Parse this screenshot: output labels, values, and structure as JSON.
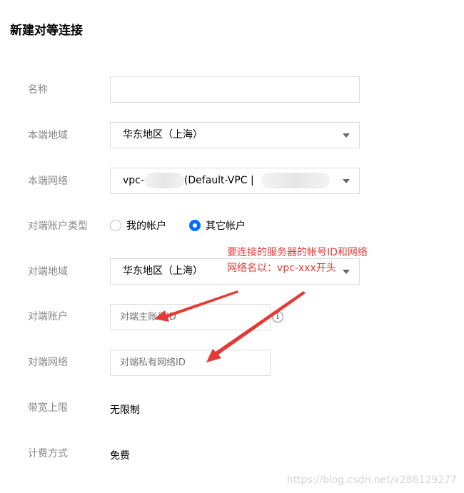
{
  "page": {
    "title": "新建对等连接"
  },
  "form": {
    "name": {
      "label": "名称",
      "value": ""
    },
    "local_region": {
      "label": "本端地域",
      "value": "华东地区（上海）"
    },
    "local_network": {
      "label": "本端网络",
      "value_prefix": "vpc-",
      "value_middle": "(Default-VPC |"
    },
    "peer_account_type": {
      "label": "对端账户类型",
      "options": [
        "我的帐户",
        "其它帐户"
      ],
      "selected": "其它帐户"
    },
    "peer_region": {
      "label": "对端地域",
      "value": "华东地区（上海）"
    },
    "peer_account": {
      "label": "对端账户",
      "placeholder": "对端主账号ID"
    },
    "peer_network": {
      "label": "对端网络",
      "placeholder": "对端私有网络ID"
    },
    "bandwidth": {
      "label": "带宽上限",
      "value": "无限制"
    },
    "billing": {
      "label": "计费方式",
      "value": "免费"
    }
  },
  "annotation": {
    "text": "要连接的服务器的帐号ID和网络\n网络名以：vpc-xxx开头",
    "color": "#e53935"
  },
  "icons": {
    "info": "info-icon",
    "dropdown": "caret-down-icon"
  },
  "accent_color": "#006eff",
  "watermark": "https://blog.csdn.net/x286129277"
}
